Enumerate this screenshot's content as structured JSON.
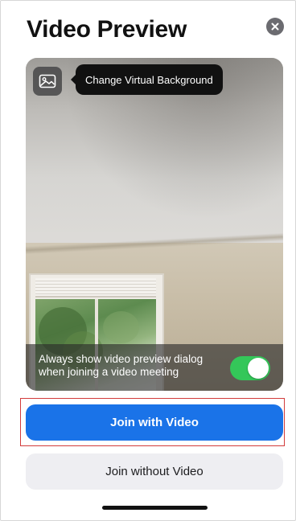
{
  "header": {
    "title": "Video Preview"
  },
  "icons": {
    "close": "close-icon",
    "virtual_background": "image-icon"
  },
  "preview": {
    "tooltip_label": "Change Virtual Background",
    "always_show_label": "Always show video preview dialog when joining a video meeting",
    "always_show_enabled": true
  },
  "actions": {
    "join_with_video": "Join with Video",
    "join_without_video": "Join without Video"
  },
  "colors": {
    "primary": "#1a73e8",
    "toggle_on": "#34c759",
    "highlight": "#d23b3b"
  }
}
